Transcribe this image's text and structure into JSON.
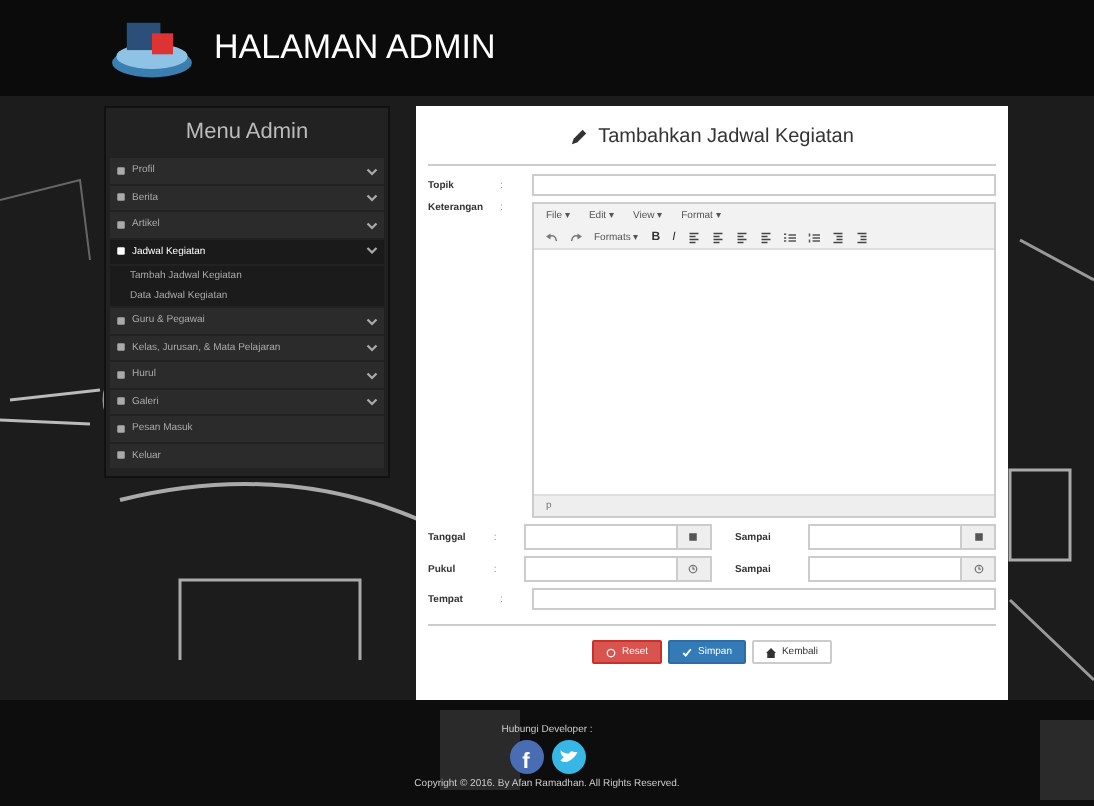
{
  "header": {
    "title": "HALAMAN ADMIN"
  },
  "sidebar": {
    "title": "Menu Admin",
    "items": [
      {
        "label": "Profil",
        "kind": "submenu",
        "selected": false,
        "expanded": false
      },
      {
        "label": "Berita",
        "kind": "submenu",
        "selected": false,
        "expanded": false
      },
      {
        "label": "Artikel",
        "kind": "submenu",
        "selected": false,
        "expanded": false
      },
      {
        "label": "Jadwal Kegiatan",
        "kind": "submenu",
        "selected": true,
        "expanded": true,
        "children": [
          {
            "label": "Tambah Jadwal Kegiatan"
          },
          {
            "label": "Data Jadwal Kegiatan"
          }
        ]
      },
      {
        "label": "Guru & Pegawai",
        "kind": "submenu",
        "selected": false,
        "expanded": false
      },
      {
        "label": "Kelas, Jurusan, & Mata Pelajaran",
        "kind": "submenu",
        "selected": false,
        "expanded": false
      },
      {
        "label": "Hurul",
        "kind": "submenu",
        "selected": false,
        "expanded": false
      },
      {
        "label": "Galeri",
        "kind": "submenu",
        "selected": false,
        "expanded": false
      },
      {
        "label": "Pesan Masuk",
        "kind": "link",
        "selected": false
      },
      {
        "label": "Keluar",
        "kind": "link",
        "selected": false
      }
    ]
  },
  "form": {
    "title": "Tambahkan Jadwal Kegiatan",
    "topic": {
      "label": "Topik",
      "separator": ":"
    },
    "description": {
      "label": "Keterangan",
      "separator": ":",
      "menus": [
        "File ▾",
        "Edit ▾",
        "View ▾",
        "Format ▾"
      ],
      "formats": "Formats ▾",
      "bold": "B",
      "italic": "I",
      "status": "p"
    },
    "date": {
      "label": "Tanggal",
      "separator": ":",
      "to_label": "Sampai"
    },
    "time": {
      "label": "Pukul",
      "separator": ":",
      "to_label": "Sampai"
    },
    "place": {
      "label": "Tempat",
      "separator": ":"
    },
    "buttons": [
      {
        "label": "Reset",
        "kind": "danger"
      },
      {
        "label": "Simpan",
        "kind": "primary"
      },
      {
        "label": "Kembali",
        "kind": "default"
      }
    ]
  },
  "footer": {
    "contact": "Hubungi Developer :",
    "facebook": "f",
    "copyright": "Copyright © 2016. By Afan Ramadhan. All Rights Reserved."
  }
}
